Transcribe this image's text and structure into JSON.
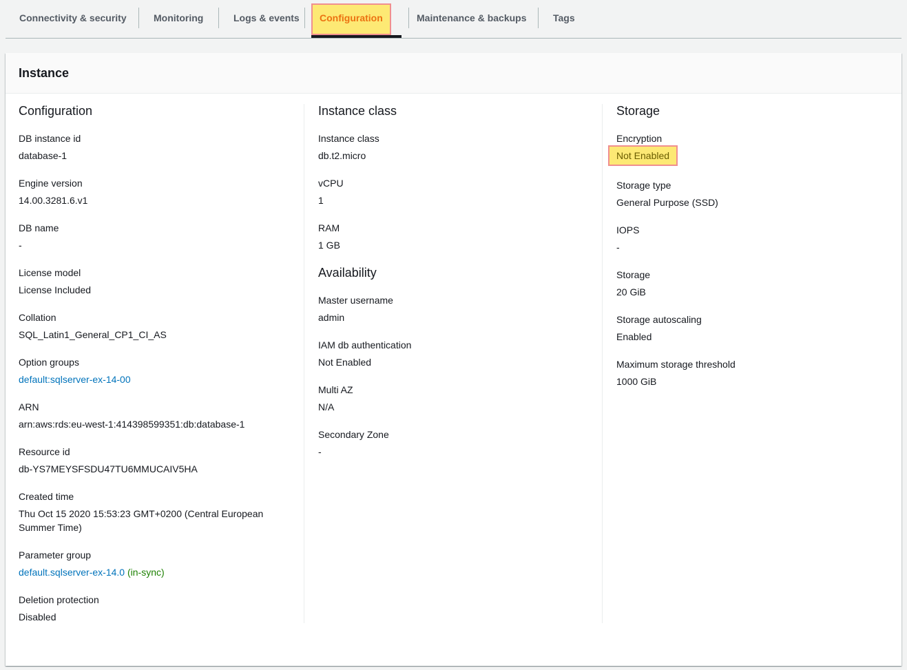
{
  "tabs": [
    {
      "label": "Connectivity & security"
    },
    {
      "label": "Monitoring"
    },
    {
      "label": "Logs & events"
    },
    {
      "label": "Configuration"
    },
    {
      "label": "Maintenance & backups"
    },
    {
      "label": "Tags"
    }
  ],
  "active_tab": "Configuration",
  "panel": {
    "title": "Instance"
  },
  "configuration": {
    "title": "Configuration",
    "items": [
      {
        "label": "DB instance id",
        "value": "database-1"
      },
      {
        "label": "Engine version",
        "value": "14.00.3281.6.v1"
      },
      {
        "label": "DB name",
        "value": "-"
      },
      {
        "label": "License model",
        "value": "License Included"
      },
      {
        "label": "Collation",
        "value": "SQL_Latin1_General_CP1_CI_AS"
      },
      {
        "label": "Option groups",
        "value": "default:sqlserver-ex-14-00"
      },
      {
        "label": "ARN",
        "value": "arn:aws:rds:eu-west-1:414398599351:db:database-1"
      },
      {
        "label": "Resource id",
        "value": "db-YS7MEYSFSDU47TU6MMUCAIV5HA"
      },
      {
        "label": "Created time",
        "value": "Thu Oct 15 2020 15:53:23 GMT+0200 (Central European Summer Time)"
      },
      {
        "label": "Parameter group",
        "value": "default.sqlserver-ex-14.0",
        "status": "(in-sync)"
      },
      {
        "label": "Deletion protection",
        "value": "Disabled"
      }
    ]
  },
  "instance_class": {
    "title": "Instance class",
    "items": [
      {
        "label": "Instance class",
        "value": "db.t2.micro"
      },
      {
        "label": "vCPU",
        "value": "1"
      },
      {
        "label": "RAM",
        "value": "1 GB"
      }
    ]
  },
  "availability": {
    "title": "Availability",
    "items": [
      {
        "label": "Master username",
        "value": "admin"
      },
      {
        "label": "IAM db authentication",
        "value": "Not Enabled"
      },
      {
        "label": "Multi AZ",
        "value": "N/A"
      },
      {
        "label": "Secondary Zone",
        "value": "-"
      }
    ]
  },
  "storage": {
    "title": "Storage",
    "items": [
      {
        "label": "Encryption",
        "value": "Not Enabled"
      },
      {
        "label": "Storage type",
        "value": "General Purpose (SSD)"
      },
      {
        "label": "IOPS",
        "value": "-"
      },
      {
        "label": "Storage",
        "value": "20 GiB"
      },
      {
        "label": "Storage autoscaling",
        "value": "Enabled"
      },
      {
        "label": "Maximum storage threshold",
        "value": "1000 GiB"
      }
    ]
  },
  "colors": {
    "link": "#0073bb",
    "in_sync": "#1d8102",
    "highlight": "#fde974",
    "highlight_border": "#f08f8f",
    "active_tab_text": "#ec7211"
  }
}
